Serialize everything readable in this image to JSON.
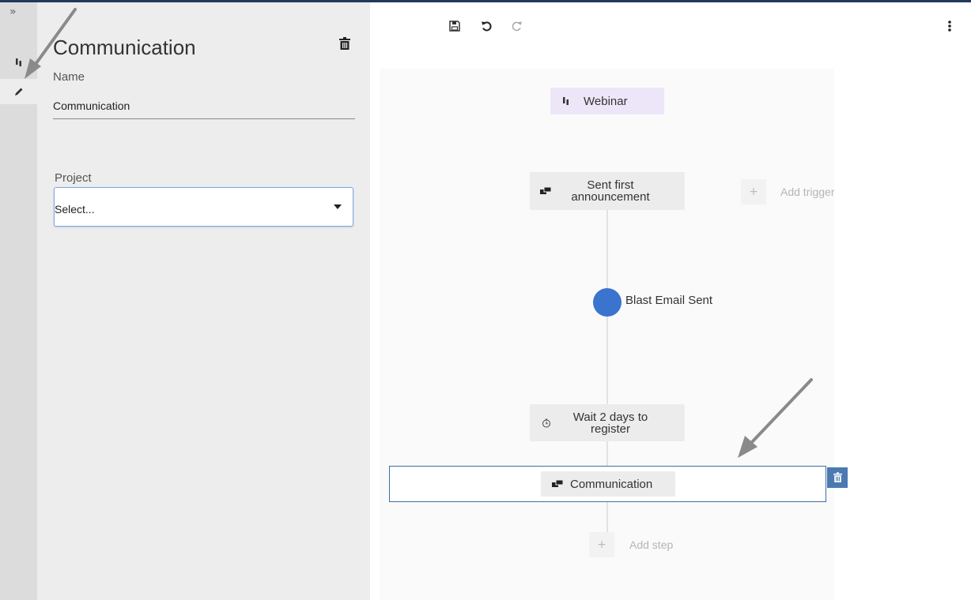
{
  "rail": {
    "expand_glyph": "»"
  },
  "panel": {
    "title": "Communication",
    "name_label": "Name",
    "name_value": "Communication",
    "project_label": "Project",
    "project_value": "Select..."
  },
  "flow": {
    "trigger": {
      "label": "Webinar",
      "icon": "signal-icon"
    },
    "nodes": [
      {
        "label": "Sent first announcement",
        "icon": "chat-bubbles-icon"
      },
      {
        "label": "Wait 2 days to register",
        "icon": "clock-icon"
      },
      {
        "label": "Communication",
        "icon": "chat-bubbles-icon"
      }
    ],
    "goal": {
      "label": "Blast Email Sent",
      "color": "#3a74cf"
    },
    "add_trigger": "Add trigger",
    "add_step": "Add step",
    "plus": "+"
  },
  "colors": {
    "accent": "#3a74cf",
    "selection": "#3e6ea6",
    "trigger_bg": "#ece6f8"
  }
}
